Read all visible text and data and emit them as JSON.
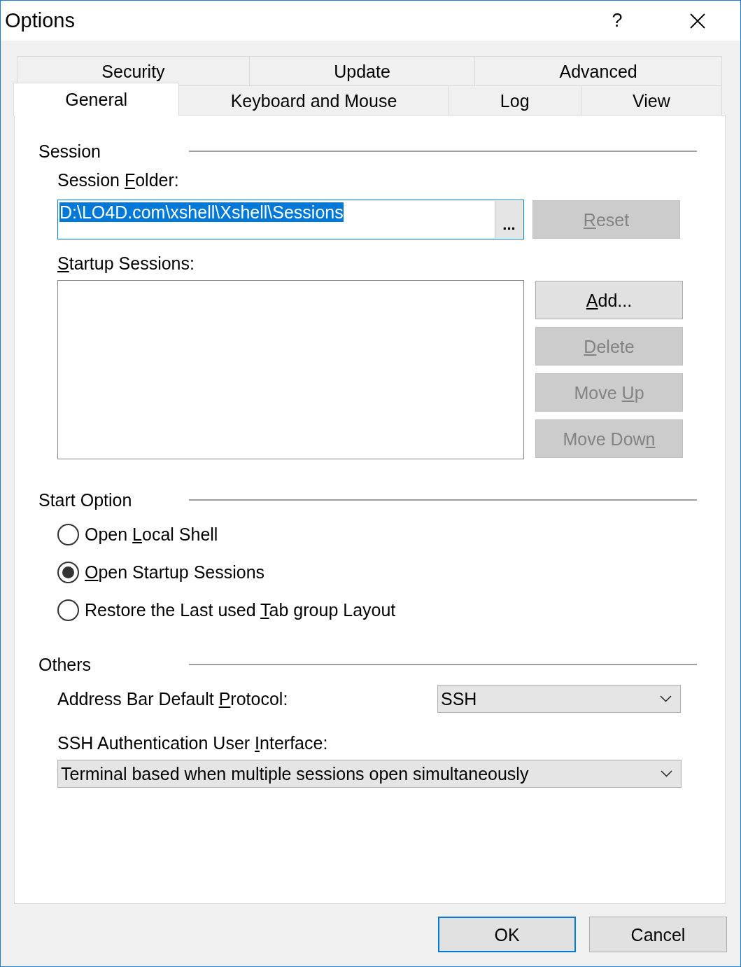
{
  "window": {
    "title": "Options",
    "help": "?"
  },
  "tab_rows": [
    {
      "tabs": [
        {
          "label": "Security",
          "selected": false
        },
        {
          "label": "Update",
          "selected": false
        },
        {
          "label": "Advanced",
          "selected": false
        }
      ]
    },
    {
      "tabs": [
        {
          "label": "General",
          "selected": true
        },
        {
          "label": "Keyboard and Mouse",
          "selected": false
        },
        {
          "label": "Log",
          "selected": false
        },
        {
          "label": "View",
          "selected": false
        }
      ]
    }
  ],
  "session": {
    "title": "Session",
    "folder_label": {
      "pre": "Session ",
      "key": "F",
      "post": "older:"
    },
    "folder_field": {
      "value": "D:\\LO4D.com\\xshell\\Xshell\\Sessions",
      "focused": true,
      "text_selected": true,
      "browse_button": "..."
    },
    "reset_button": {
      "label": {
        "key": "R",
        "post": "eset"
      },
      "disabled": true
    },
    "startup_label": {
      "key": "S",
      "post": "tartup Sessions:"
    },
    "startup_buttons": [
      {
        "label": {
          "key": "A",
          "post": "dd..."
        },
        "disabled": false
      },
      {
        "label": {
          "key": "D",
          "post": "elete"
        },
        "disabled": true
      },
      {
        "label": {
          "pre": "Move ",
          "key": "U",
          "post": "p"
        },
        "disabled": true
      },
      {
        "label": {
          "pre": "Move Dow",
          "key": "n"
        },
        "disabled": true
      }
    ]
  },
  "start_option": {
    "title": "Start Option",
    "options": [
      {
        "label": {
          "pre": "Open ",
          "key": "L",
          "post": "ocal Shell"
        },
        "selected": false
      },
      {
        "label": {
          "key": "O",
          "post": "pen Startup Sessions"
        },
        "selected": true
      },
      {
        "label": {
          "pre": "Restore the Last used ",
          "key": "T",
          "post": "ab group Layout"
        },
        "selected": false
      }
    ]
  },
  "others": {
    "title": "Others",
    "fields": [
      {
        "kind": "inline",
        "label": {
          "pre": "Address Bar Default ",
          "key": "P",
          "post": "rotocol:"
        },
        "value": "SSH"
      },
      {
        "kind": "stacked",
        "label": {
          "pre": "SSH Authentication User ",
          "key": "I",
          "post": "nterface:"
        },
        "value": "Terminal based when multiple sessions open simultaneously"
      }
    ]
  },
  "footer_buttons": [
    {
      "label": "OK",
      "focused": true
    },
    {
      "label": "Cancel",
      "focused": false
    }
  ]
}
